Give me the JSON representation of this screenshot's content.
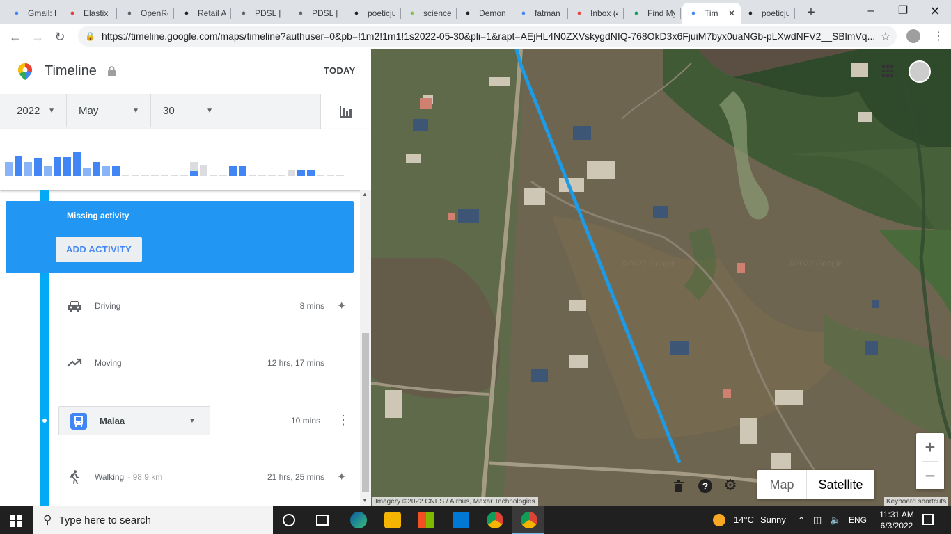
{
  "browser": {
    "tabs": [
      {
        "label": "Gmail: F",
        "icon": "google-icon",
        "color": "#4285f4"
      },
      {
        "label": "Elastix",
        "icon": "elastix-icon",
        "color": "#e53935"
      },
      {
        "label": "OpenRe",
        "icon": "document-icon",
        "color": "#5f6368"
      },
      {
        "label": "Retail A",
        "icon": "ra-icon",
        "color": "#202124"
      },
      {
        "label": "PDSL | \\",
        "icon": "document-icon",
        "color": "#5f6368"
      },
      {
        "label": "PDSL | \\",
        "icon": "document-icon",
        "color": "#5f6368"
      },
      {
        "label": "poeticju",
        "icon": "github-icon",
        "color": "#202124"
      },
      {
        "label": "science",
        "icon": "science-icon",
        "color": "#8bc34a"
      },
      {
        "label": "Demon",
        "icon": "wikipedia-icon",
        "color": "#202124"
      },
      {
        "label": "fatman",
        "icon": "google-icon",
        "color": "#4285f4"
      },
      {
        "label": "Inbox (4",
        "icon": "gmail-icon",
        "color": "#ea4335"
      },
      {
        "label": "Find My",
        "icon": "find-my-icon",
        "color": "#0f9d58"
      },
      {
        "label": "Tim",
        "icon": "maps-pin-icon",
        "color": "#4285f4",
        "active": true
      },
      {
        "label": "poeticju",
        "icon": "github-icon",
        "color": "#202124"
      }
    ],
    "new_tab": "+",
    "url": "https://timeline.google.com/maps/timeline?authuser=0&pb=!1m2!1m1!1s2022-05-30&pli=1&rapt=AEjHL4N0ZXVskygdNIQ-768OkD3x6FjuiM7byx0uaNGb-pLXwdNFV2__SBlmVq..."
  },
  "timeline": {
    "title": "Timeline",
    "today_label": "TODAY",
    "date": {
      "year": "2022",
      "month": "May",
      "day": "30"
    },
    "histogram": [
      {
        "h": 0.6,
        "s": "light"
      },
      {
        "h": 0.85,
        "s": "blue"
      },
      {
        "h": 0.6,
        "s": "light"
      },
      {
        "h": 0.75,
        "s": "blue"
      },
      {
        "h": 0.4,
        "s": "light"
      },
      {
        "h": 0.8,
        "s": "blue"
      },
      {
        "h": 0.8,
        "s": "blue"
      },
      {
        "h": 1.0,
        "s": "blue"
      },
      {
        "h": 0.35,
        "s": "light"
      },
      {
        "h": 0.6,
        "s": "blue"
      },
      {
        "h": 0.4,
        "s": "light"
      },
      {
        "h": 0.4,
        "s": "blue"
      },
      {
        "h": 0.0,
        "s": "empty"
      },
      {
        "h": 0.0,
        "s": "empty"
      },
      {
        "h": 0.0,
        "s": "empty"
      },
      {
        "h": 0.0,
        "s": "empty"
      },
      {
        "h": 0.0,
        "s": "empty"
      },
      {
        "h": 0.0,
        "s": "empty"
      },
      {
        "h": 0.0,
        "s": "empty"
      },
      {
        "h": 0.6,
        "s": "mixed"
      },
      {
        "h": 0.45,
        "s": "grey"
      },
      {
        "h": 0.0,
        "s": "empty"
      },
      {
        "h": 0.0,
        "s": "empty"
      },
      {
        "h": 0.4,
        "s": "blue"
      },
      {
        "h": 0.4,
        "s": "blue"
      },
      {
        "h": 0.0,
        "s": "empty"
      },
      {
        "h": 0.0,
        "s": "empty"
      },
      {
        "h": 0.0,
        "s": "empty"
      },
      {
        "h": 0.0,
        "s": "empty"
      },
      {
        "h": 0.25,
        "s": "grey"
      },
      {
        "h": 0.25,
        "s": "blue"
      },
      {
        "h": 0.25,
        "s": "blue"
      },
      {
        "h": 0.0,
        "s": "empty"
      },
      {
        "h": 0.0,
        "s": "empty"
      },
      {
        "h": 0.0,
        "s": "empty"
      }
    ],
    "missing": {
      "title": "Missing activity",
      "button": "ADD ACTIVITY"
    },
    "activities": [
      {
        "label": "Driving",
        "duration": "8 mins",
        "icon": "car-icon"
      },
      {
        "label": "Moving",
        "duration": "12 hrs, 17 mins",
        "icon": "trending-icon"
      },
      {
        "label": "Malaa",
        "duration": "10 mins",
        "icon": "bus-icon"
      },
      {
        "label": "Walking",
        "distance": "- 98,9 km",
        "duration": "21 hrs, 25 mins",
        "icon": "walking-icon"
      }
    ]
  },
  "map": {
    "type_map": "Map",
    "type_satellite": "Satellite",
    "zoom_in": "+",
    "zoom_out": "−",
    "attribution": "Imagery ©2022 CNES / Airbus, Maxar Technologies",
    "keyboard": "Keyboard shortcuts",
    "watermark": "©2022 Google"
  },
  "taskbar": {
    "search_placeholder": "Type here to search",
    "weather_temp": "14°C",
    "weather_text": "Sunny",
    "lang": "ENG",
    "time": "11:31 AM",
    "date": "6/3/2022"
  }
}
